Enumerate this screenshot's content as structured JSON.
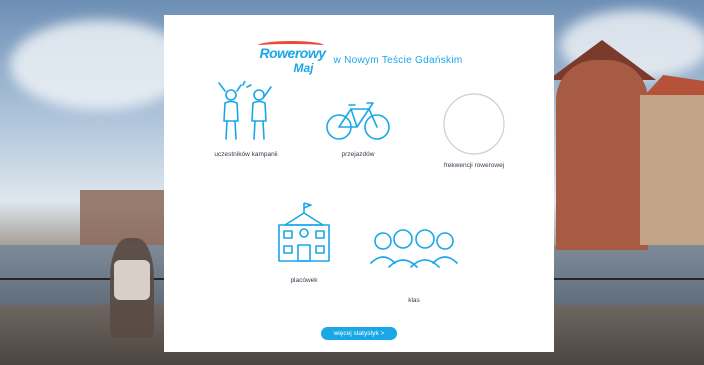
{
  "header": {
    "logo_line1": "Rowerowy",
    "logo_line2": "Maj",
    "subtitle": "w Nowym Teście Gdańskim"
  },
  "stats": {
    "participants_label": "uczestników kampanii",
    "rides_label": "przejazdów",
    "turnout_label": "frekwencji rowerowej",
    "schools_label": "placówek",
    "classes_label": "klas"
  },
  "cta": {
    "label": "więcej statystyk >"
  },
  "colors": {
    "accent": "#1aa7e8",
    "label_text": "#333b4d"
  }
}
